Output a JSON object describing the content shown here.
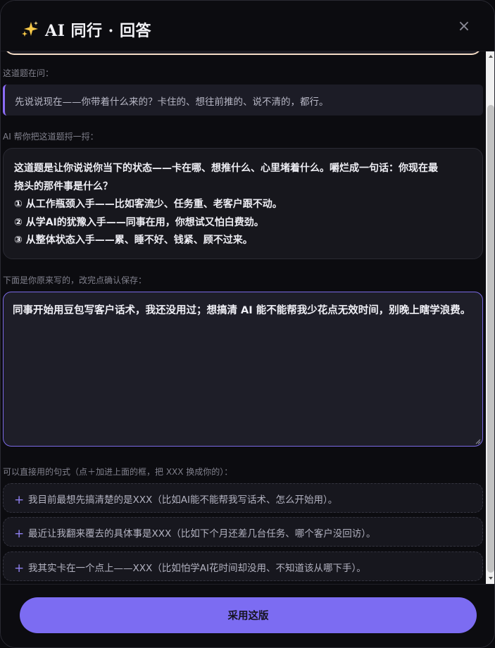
{
  "header": {
    "title": "AI 同行 · 回答",
    "sparkle_icon": "sparkles-icon",
    "close_label": "×"
  },
  "content": {
    "question_label": "这道题在问：",
    "question_text": "先说说现在——你带着什么来的？卡住的、想往前推的、说不清的，都行。",
    "explain_label": "AI 帮你把这道题捋一捋：",
    "explain_lines": [
      "这道题是让你说说你当下的状态——卡在哪、想推什么、心里堵着什么。嚼烂成一句话：你现在最",
      "挠头的那件事是什么？",
      "① 从工作瓶颈入手——比如客流少、任务重、老客户跟不动。",
      "② 从学AI的犹豫入手——同事在用，你想试又怕白费劲。",
      "③ 从整体状态入手——累、睡不好、钱紧、顾不过来。"
    ],
    "editor_label": "下面是你原来写的，改完点确认保存：",
    "editor_value": "同事开始用豆包写客户话术，我还没用过；想搞清 AI 能不能帮我少花点无效时间，别晚上瞎学浪费。",
    "templates_label": "可以直接用的句式（点＋加进上面的框，把 XXX 换成你的）：",
    "templates": [
      "我目前最想先搞清楚的是XXX（比如AI能不能帮我写话术、怎么开始用）。",
      "最近让我翻来覆去的具体事是XXX（比如下个月还差几台任务、哪个客户没回访）。",
      "我其实卡在一个点上——XXX（比如怕学AI花时间却没用、不知道该从哪下手）。"
    ],
    "plus_glyph": "+"
  },
  "footer": {
    "apply_label": "采用这版"
  },
  "colors": {
    "accent": "#7c6cf2",
    "editor_border": "#7b6ae6",
    "question_bar": "#8b6cf6",
    "peek_border": "#f4dcc6"
  }
}
